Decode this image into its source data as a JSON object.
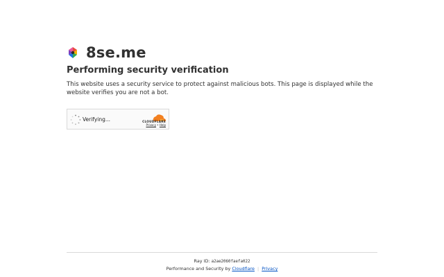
{
  "site": {
    "name": "8se.me",
    "favicon": "favicon-icon"
  },
  "heading": "Performing security verification",
  "description": "This website uses a security service to protect against malicious bots. This page is displayed while the website verifies you are not a bot.",
  "widget": {
    "status": "Verifying...",
    "spinner": "loading-spinner-icon",
    "brand": "CLOUDFLARE",
    "privacy_link": "Privacy",
    "separator": "•",
    "help_link": "Help",
    "brand_color": "#f38020"
  },
  "footer": {
    "ray_label": "Ray ID:",
    "ray_id": "a2ae2060faefa022",
    "perf_text": "Performance and Security by",
    "cloudflare_link": "Cloudflare",
    "separator": "|",
    "privacy_link": "Privacy",
    "link_color": "#0051c3"
  }
}
